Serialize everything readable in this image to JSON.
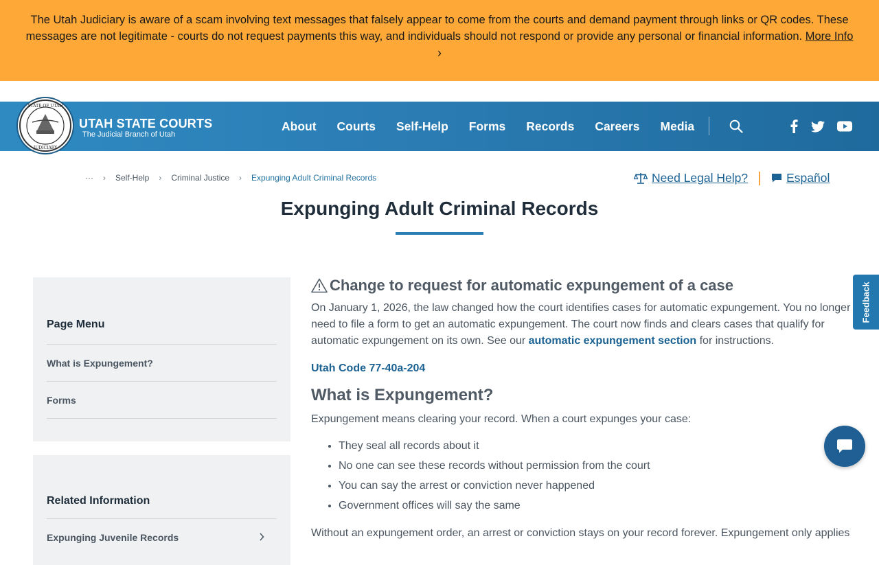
{
  "alert": {
    "message": "The Utah Judiciary is aware of a scam involving text messages that falsely appear to come from the courts and demand payment through links or QR codes. These messages are not legitimate - courts do not request payments this way, and individuals should not respond or provide any personal or financial information.",
    "link_label": "More Info",
    "chevron": "›"
  },
  "header": {
    "brand_title": "UTAH STATE COURTS",
    "brand_subtitle": "The Judicial Branch of Utah",
    "seal_text_top": "STATE OF UTAH",
    "seal_text_bottom": "JUDICIARY",
    "nav": [
      "About",
      "Courts",
      "Self-Help",
      "Forms",
      "Records",
      "Careers",
      "Media"
    ],
    "icons": [
      "search-icon",
      "facebook-icon",
      "twitter-icon",
      "youtube-icon"
    ]
  },
  "breadcrumb": {
    "ellipsis": "···",
    "items": [
      "Self-Help",
      "Criminal Justice"
    ],
    "current": "Expunging Adult Criminal Records",
    "separator": "›"
  },
  "utility_links": {
    "legal_help": "Need Legal Help?",
    "espanol": "Español"
  },
  "page": {
    "title": "Expunging Adult Criminal Records"
  },
  "sidebar": {
    "page_menu": {
      "heading": "Page Menu",
      "items": [
        "What is Expungement?",
        "Forms"
      ]
    },
    "related": {
      "heading": "Related Information",
      "items": [
        "Expunging Juvenile Records"
      ]
    }
  },
  "main": {
    "notice_heading": "Change to request for automatic expungement of a case",
    "notice_text_before": "On January 1, 2026, the law changed how the court identifies cases for automatic expungement. You no longer need to file a form to get an automatic expungement. The court now finds and clears cases that qualify for automatic expungement on its own. See our",
    "notice_link": "automatic expungement section",
    "notice_text_after": "for instructions.",
    "code_link": "Utah Code 77-40a-204",
    "section_heading": "What is Expungement?",
    "section_intro": "Expungement means clearing your record. When a court expunges your case:",
    "bullets": [
      "They seal all records about it",
      "No one can see these records without permission from the court",
      "You can say the arrest or conviction never happened",
      "Government offices will say the same"
    ],
    "closing_text": "Without an expungement order, an arrest or conviction stays on your record forever. Expungement only applies"
  },
  "widgets": {
    "feedback_label": "Feedback",
    "chat_icon": "chat-bubble-icon"
  },
  "colors": {
    "alert_bg": "#fda837",
    "header_blue": "#2b7db4",
    "link_blue": "#1b6293",
    "accent_orange": "#f5a33a"
  }
}
